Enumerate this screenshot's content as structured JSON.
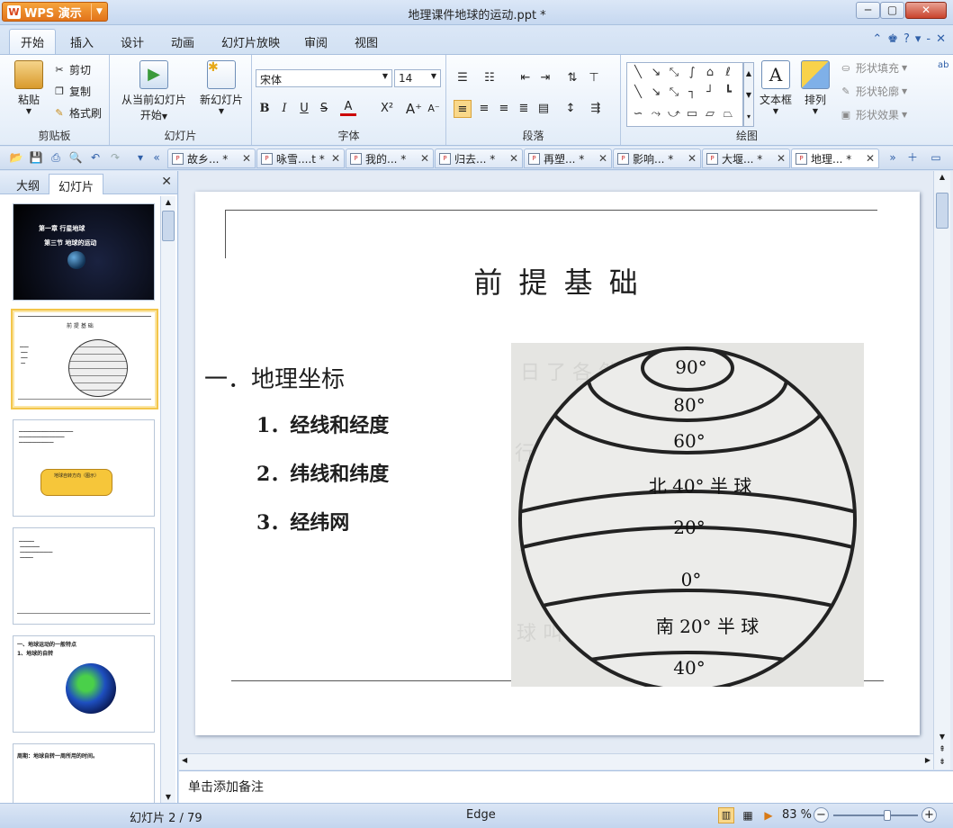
{
  "app": {
    "name": "WPS 演示",
    "window_title": "地理课件地球的运动.ppt *"
  },
  "ribbon_tabs": [
    "开始",
    "插入",
    "设计",
    "动画",
    "幻灯片放映",
    "审阅",
    "视图"
  ],
  "ribbon": {
    "clipboard": {
      "paste": "粘贴",
      "cut": "剪切",
      "copy": "复制",
      "format_painter": "格式刷",
      "label": "剪贴板"
    },
    "slides": {
      "from_current": "从当前幻灯片",
      "start": "开始",
      "new_slide": "新幻灯片",
      "label": "幻灯片"
    },
    "font": {
      "name": "宋体",
      "size": "14",
      "label": "字体"
    },
    "paragraph": {
      "label": "段落"
    },
    "drawing": {
      "textbox": "文本框",
      "arrange": "排列",
      "shape_fill": "形状填充",
      "shape_outline": "形状轮廓",
      "shape_effect": "形状效果",
      "label": "绘图"
    }
  },
  "doc_tabs": [
    {
      "label": "故乡... *",
      "active": false
    },
    {
      "label": "咏雪....t *",
      "active": false
    },
    {
      "label": "我的... *",
      "active": false
    },
    {
      "label": "归去... *",
      "active": false
    },
    {
      "label": "再塑... *",
      "active": false
    },
    {
      "label": "影响... *",
      "active": false
    },
    {
      "label": "大堰... *",
      "active": false
    },
    {
      "label": "地理... *",
      "active": true
    }
  ],
  "left_panel": {
    "tabs": [
      "大纲",
      "幻灯片"
    ],
    "active_tab": "幻灯片",
    "thumbnails": [
      {
        "num": "1",
        "lines": [
          "第一章 行星地球",
          "第三节 地球的运动"
        ]
      },
      {
        "num": "2",
        "lines": [
          "前 提 基 础"
        ]
      },
      {
        "num": "3",
        "lines": [
          "地球自转方向（图示）"
        ]
      },
      {
        "num": "4",
        "lines": []
      },
      {
        "num": "5",
        "lines": [
          "一、地球运动的一般特点",
          "1、地球的自转"
        ]
      },
      {
        "num": "6",
        "lines": [
          "周期：地球自转一周所用的时间。"
        ]
      }
    ]
  },
  "slide": {
    "title": "前 提 基 础",
    "heading": "一．地理坐标",
    "items": [
      "1．经线和经度",
      "2．纬线和纬度",
      "3．经纬网"
    ],
    "globe_labels": {
      "lat90": "90°",
      "lat80": "80°",
      "lat60": "60°",
      "north": "北 40° 半 球",
      "lat20n": "20°",
      "lat0": "0°",
      "south": "南 20° 半 球",
      "lat40s": "40°"
    }
  },
  "notes_placeholder": "单击添加备注",
  "status": {
    "slide_info": "幻灯片 2 / 79",
    "theme": "Edge",
    "zoom": "83 %",
    "zoom_level": 0.83
  },
  "colors": {
    "accent": "#e2731a",
    "ribbon_bg": "#dbe7f7",
    "selection": "#f3c64b"
  }
}
